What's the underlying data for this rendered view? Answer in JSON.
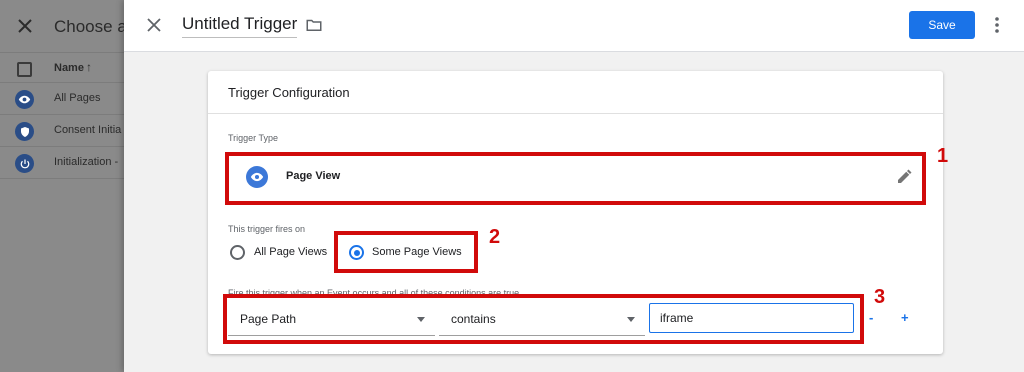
{
  "background": {
    "title": "Choose a",
    "column_header": "Name",
    "sort_arrow": "↑",
    "rows": [
      {
        "label": "All Pages",
        "icon": "eye-icon"
      },
      {
        "label": "Consent Initia",
        "icon": "shield-icon"
      },
      {
        "label": "Initialization -",
        "icon": "power-icon"
      }
    ]
  },
  "header": {
    "title": "Untitled Trigger",
    "save_label": "Save"
  },
  "card": {
    "title": "Trigger Configuration",
    "trigger_type_label": "Trigger Type",
    "trigger_type_value": "Page View",
    "fires_on_label": "This trigger fires on",
    "radio_all": "All Page Views",
    "radio_some": "Some Page Views",
    "condition_label": "Fire this trigger when an Event occurs and all of these conditions are true",
    "condition": {
      "variable": "Page Path",
      "operator": "contains",
      "value": "iframe"
    },
    "minus": "-",
    "plus": "+"
  },
  "annotations": {
    "one": "1",
    "two": "2",
    "three": "3",
    "color": "#d10a0a"
  },
  "colors": {
    "accent": "#1a73e8",
    "trigger_icon": "#3c78d8"
  }
}
